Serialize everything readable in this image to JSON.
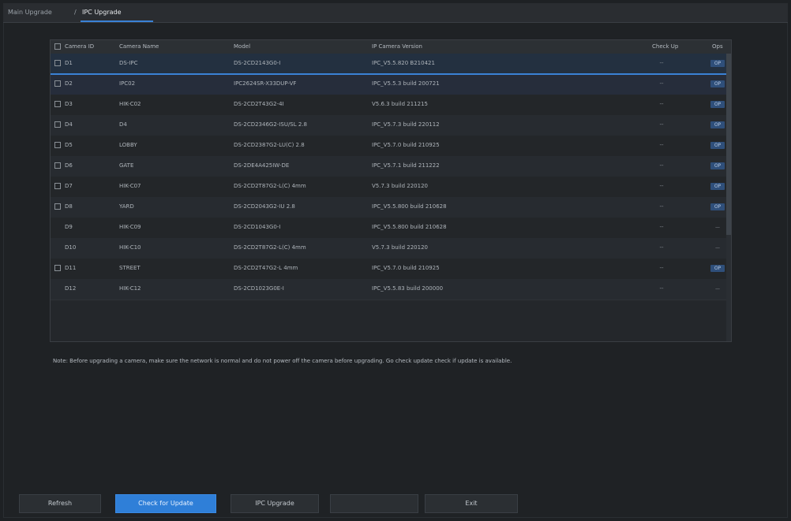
{
  "breadcrumb": {
    "home": "Main Upgrade",
    "separator": "/",
    "active": "IPC Upgrade"
  },
  "table": {
    "headers": {
      "camera_id": "Camera ID",
      "camera_name": "Camera Name",
      "model": "Model",
      "version": "IP Camera Version",
      "check_up": "Check Up",
      "ops": "Ops"
    },
    "rows": [
      {
        "id": "D1",
        "name": "DS-IPC",
        "model": "DS-2CD2143G0-I",
        "version": "IPC_V5.5.820 B210421",
        "check": "--",
        "op": "OP",
        "has_checkbox": true
      },
      {
        "id": "D2",
        "name": "IPC02",
        "model": "IPC2624SR-X33DUP-VF",
        "version": "IPC_V5.5.3 build 200721",
        "check": "--",
        "op": "OP",
        "has_checkbox": true
      },
      {
        "id": "D3",
        "name": "HIK-C02",
        "model": "DS-2CD2T43G2-4I",
        "version": "V5.6.3 build 211215",
        "check": "--",
        "op": "OP",
        "has_checkbox": true
      },
      {
        "id": "D4",
        "name": "D4",
        "model": "DS-2CD2346G2-ISU/SL 2.8",
        "version": "IPC_V5.7.3 build 220112",
        "check": "--",
        "op": "OP",
        "has_checkbox": true
      },
      {
        "id": "D5",
        "name": "LOBBY",
        "model": "DS-2CD2387G2-LU(C) 2.8",
        "version": "IPC_V5.7.0 build 210925",
        "check": "--",
        "op": "OP",
        "has_checkbox": true
      },
      {
        "id": "D6",
        "name": "GATE",
        "model": "DS-2DE4A425IW-DE",
        "version": "IPC_V5.7.1 build 211222",
        "check": "--",
        "op": "OP",
        "has_checkbox": true
      },
      {
        "id": "D7",
        "name": "HIK-C07",
        "model": "DS-2CD2T87G2-L(C) 4mm",
        "version": "V5.7.3 build 220120",
        "check": "--",
        "op": "OP",
        "has_checkbox": true
      },
      {
        "id": "D8",
        "name": "YARD",
        "model": "DS-2CD2043G2-IU 2.8",
        "version": "IPC_V5.5.800 build 210628",
        "check": "--",
        "op": "OP",
        "has_checkbox": true
      },
      {
        "id": "D9",
        "name": "HIK-C09",
        "model": "DS-2CD1043G0-I",
        "version": "IPC_V5.5.800 build 210628",
        "check": "--",
        "op": "—",
        "has_checkbox": false
      },
      {
        "id": "D10",
        "name": "HIK-C10",
        "model": "DS-2CD2T87G2-L(C) 4mm",
        "version": "V5.7.3 build 220120",
        "check": "--",
        "op": "—",
        "has_checkbox": false
      },
      {
        "id": "D11",
        "name": "STREET",
        "model": "DS-2CD2T47G2-L 4mm",
        "version": "IPC_V5.7.0 build 210925",
        "check": "--",
        "op": "OP",
        "has_checkbox": true
      },
      {
        "id": "D12",
        "name": "HIK-C12",
        "model": "DS-2CD1023G0E-I",
        "version": "IPC_V5.5.83 build 200000",
        "check": "--",
        "op": "—",
        "has_checkbox": false
      }
    ]
  },
  "note": "Note: Before upgrading a camera, make sure the network is normal and do not power off the camera before upgrading. Go check update check if update is available.",
  "buttons": {
    "refresh": "Refresh",
    "check_update": "Check for Update",
    "ipc_upgrade": "IPC Upgrade",
    "disabled": "",
    "exit": "Exit"
  },
  "colors": {
    "accent": "#2f7fd8",
    "background": "#1e2124",
    "table_bg": "#24272b"
  }
}
